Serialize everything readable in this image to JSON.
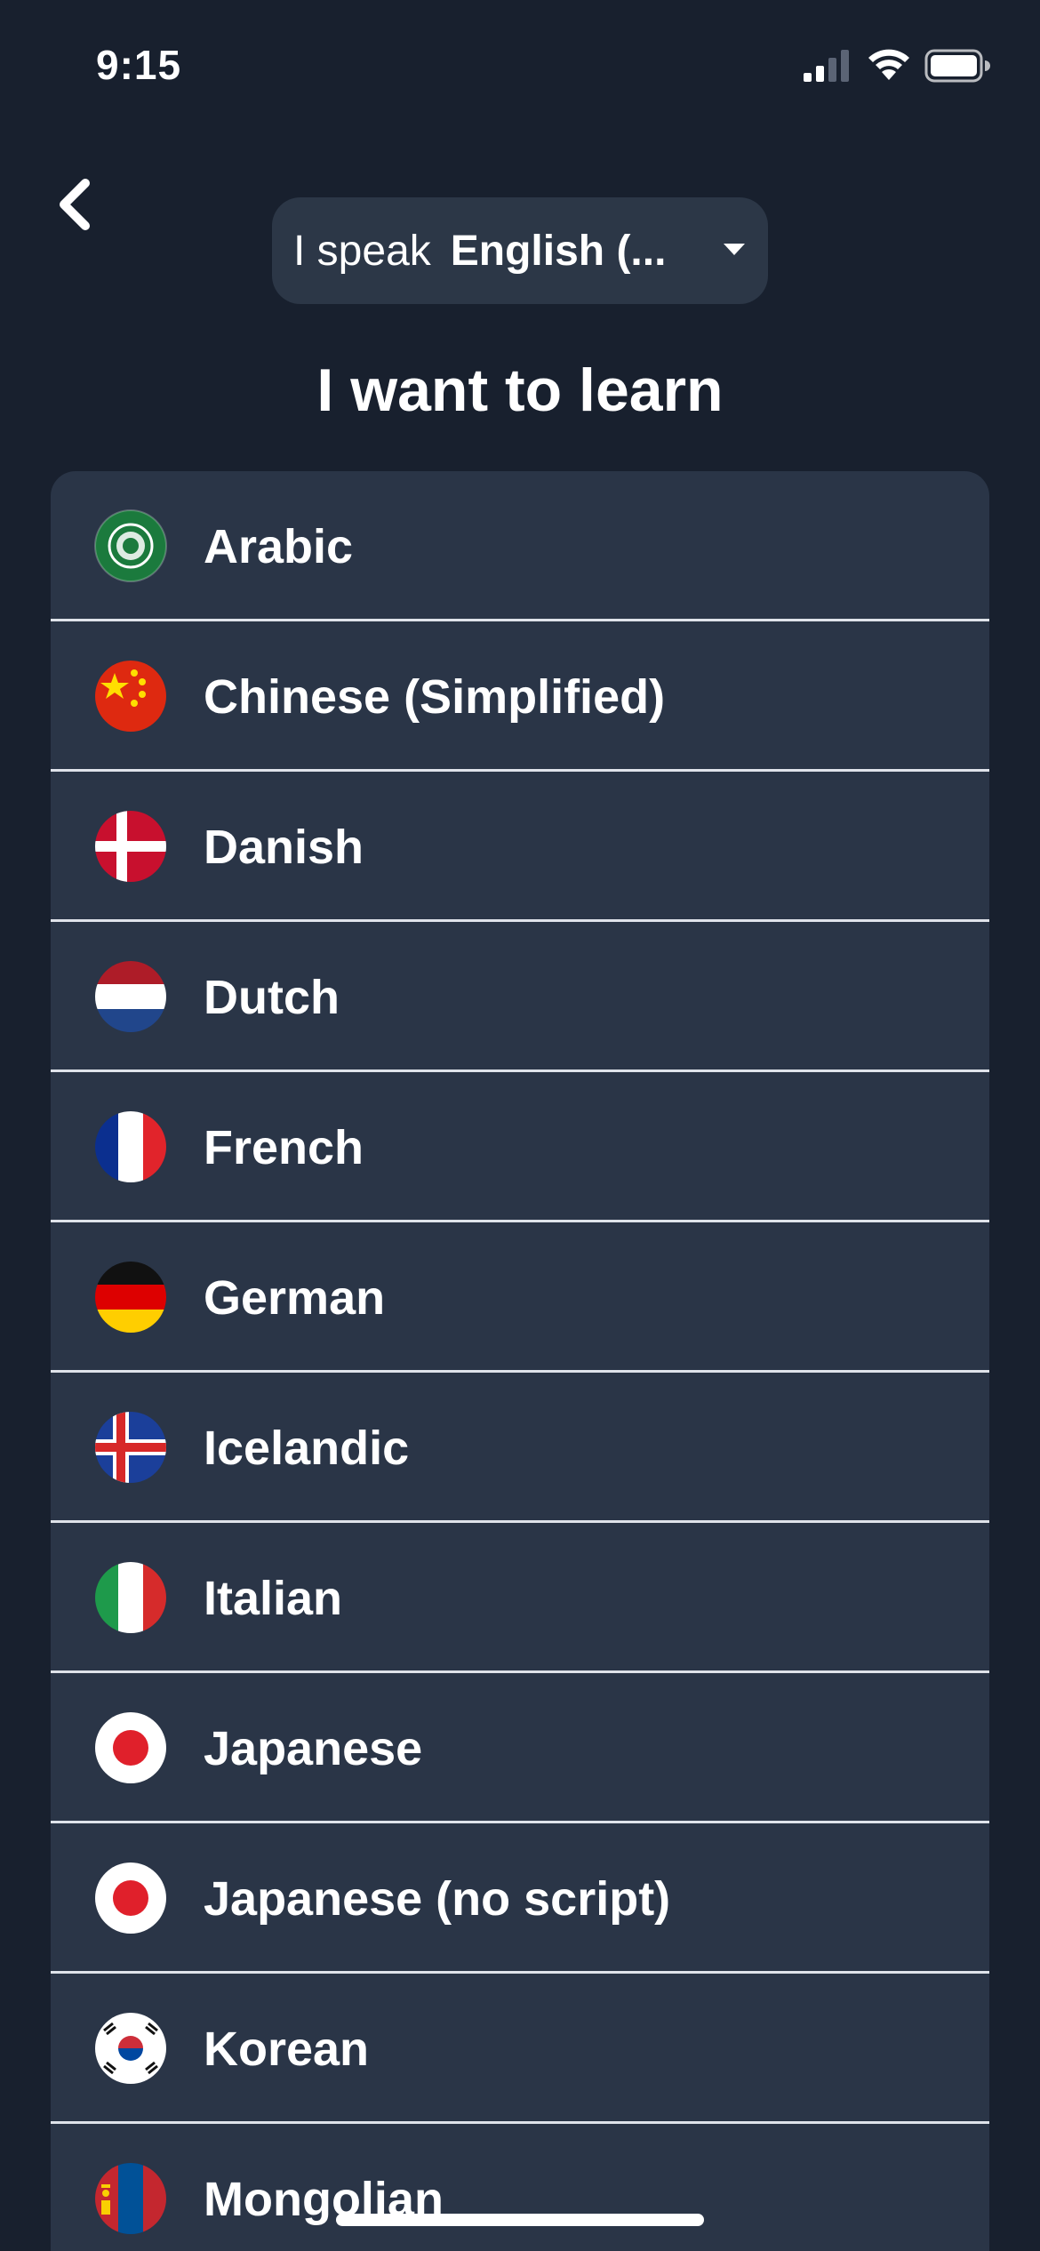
{
  "status_bar": {
    "time": "9:15",
    "icons": [
      "cellular-signal-icon",
      "wifi-icon",
      "battery-icon"
    ]
  },
  "header": {
    "back_icon": "chevron-left-icon",
    "picker_prefix": "I speak",
    "picker_value": "English (...",
    "picker_icon": "caret-down-icon"
  },
  "heading": "I want to learn",
  "languages": [
    {
      "label": "Arabic",
      "flag": "arabic-flag-icon"
    },
    {
      "label": "Chinese (Simplified)",
      "flag": "china-flag-icon"
    },
    {
      "label": "Danish",
      "flag": "denmark-flag-icon"
    },
    {
      "label": "Dutch",
      "flag": "netherlands-flag-icon"
    },
    {
      "label": "French",
      "flag": "france-flag-icon"
    },
    {
      "label": "German",
      "flag": "germany-flag-icon"
    },
    {
      "label": "Icelandic",
      "flag": "iceland-flag-icon"
    },
    {
      "label": "Italian",
      "flag": "italy-flag-icon"
    },
    {
      "label": "Japanese",
      "flag": "japan-flag-icon"
    },
    {
      "label": "Japanese (no script)",
      "flag": "japan-flag-icon"
    },
    {
      "label": "Korean",
      "flag": "south-korea-flag-icon"
    },
    {
      "label": "Mongolian",
      "flag": "mongolia-flag-icon"
    }
  ],
  "colors": {
    "background": "#18202e",
    "list_background": "#2a3547",
    "picker_background": "#2c3747",
    "divider": "#dfe3ea",
    "text": "#ffffff"
  }
}
